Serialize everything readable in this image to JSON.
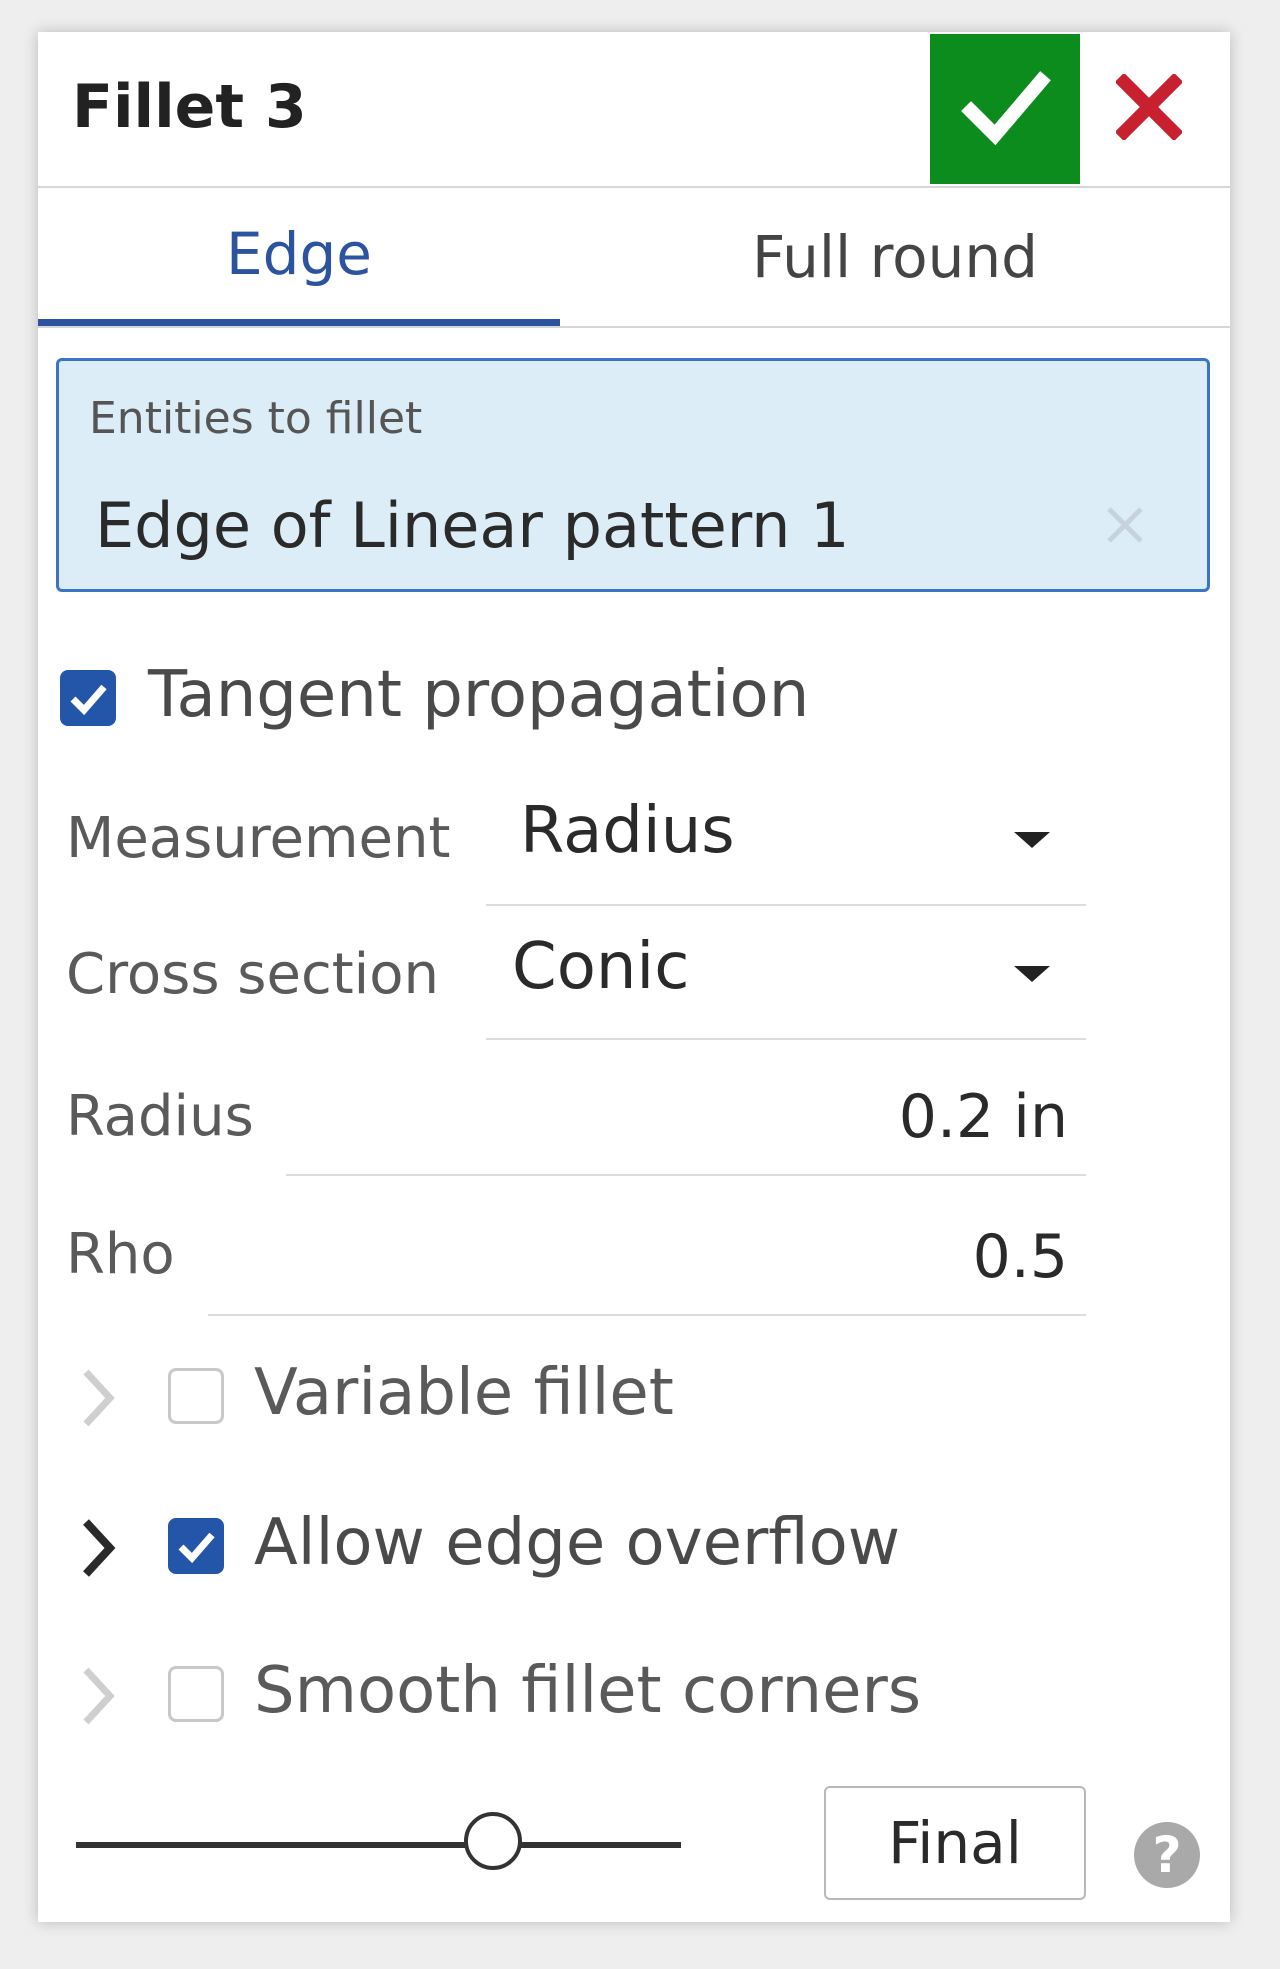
{
  "dialog": {
    "title": "Fillet 3",
    "ok_icon": "checkmark-icon",
    "cancel_icon": "close-x-icon",
    "accent_color": "#2c53a0",
    "ok_color": "#0c8c1c",
    "cancel_color": "#c8202e"
  },
  "tabs": [
    {
      "label": "Edge",
      "selected": true
    },
    {
      "label": "Full round",
      "selected": false
    }
  ],
  "entities": {
    "label": "Entities to fillet",
    "value": "Edge of Linear pattern 1",
    "clear_icon": "clear-x-icon"
  },
  "tangent_propagation": {
    "label": "Tangent propagation",
    "checked": true
  },
  "measurement": {
    "label": "Measurement",
    "value": "Radius"
  },
  "cross_section": {
    "label": "Cross section",
    "value": "Conic"
  },
  "radius": {
    "label": "Radius",
    "value": "0.2 in"
  },
  "rho": {
    "label": "Rho",
    "value": "0.5"
  },
  "options": [
    {
      "label": "Variable fillet",
      "checked": false,
      "enabled": false
    },
    {
      "label": "Allow edge overflow",
      "checked": true,
      "enabled": true
    },
    {
      "label": "Smooth fillet corners",
      "checked": false,
      "enabled": false
    }
  ],
  "footer": {
    "final_label": "Final",
    "help_glyph": "?",
    "help_icon": "help-icon",
    "slider_level": 0.69
  }
}
